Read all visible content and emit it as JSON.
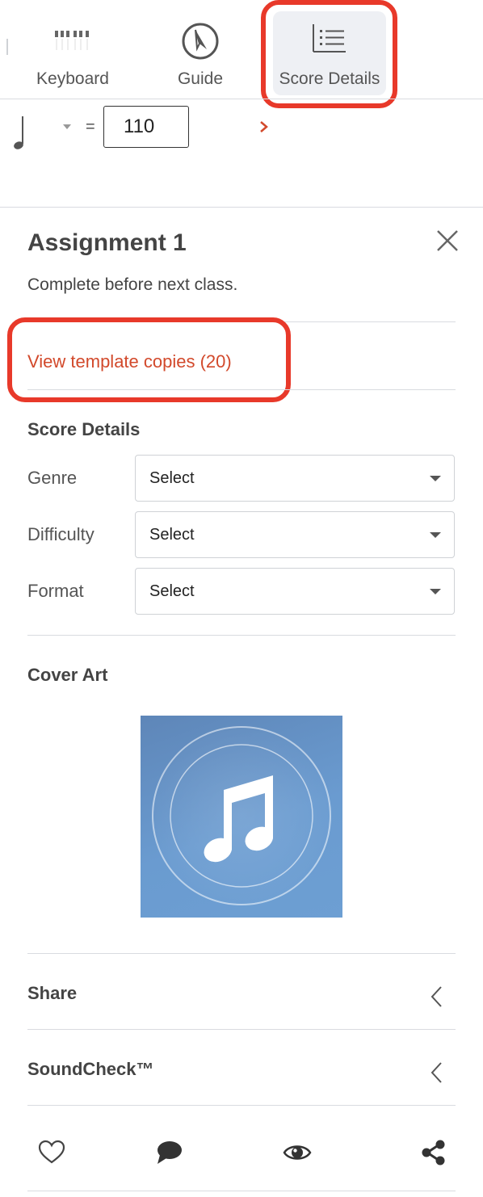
{
  "toolbar": {
    "keyboard_label": "Keyboard",
    "guide_label": "Guide",
    "score_details_label": "Score Details"
  },
  "tempo": {
    "equals": "=",
    "value": "110"
  },
  "assignment": {
    "title": "Assignment 1",
    "description": "Complete before next class.",
    "view_copies": "View template copies (20)"
  },
  "score_details": {
    "heading": "Score Details",
    "fields": [
      {
        "label": "Genre",
        "value": "Select"
      },
      {
        "label": "Difficulty",
        "value": "Select"
      },
      {
        "label": "Format",
        "value": "Select"
      }
    ]
  },
  "cover_art": {
    "heading": "Cover Art"
  },
  "rows": [
    {
      "label": "Share"
    },
    {
      "label": "SoundCheck™"
    }
  ],
  "bottom_icons": [
    "heart-icon",
    "comment-icon",
    "eye-icon",
    "share-icon"
  ],
  "colors": {
    "accent": "#d2492b",
    "highlight": "#e8392a",
    "cover_bg": "#6a9bd0"
  }
}
